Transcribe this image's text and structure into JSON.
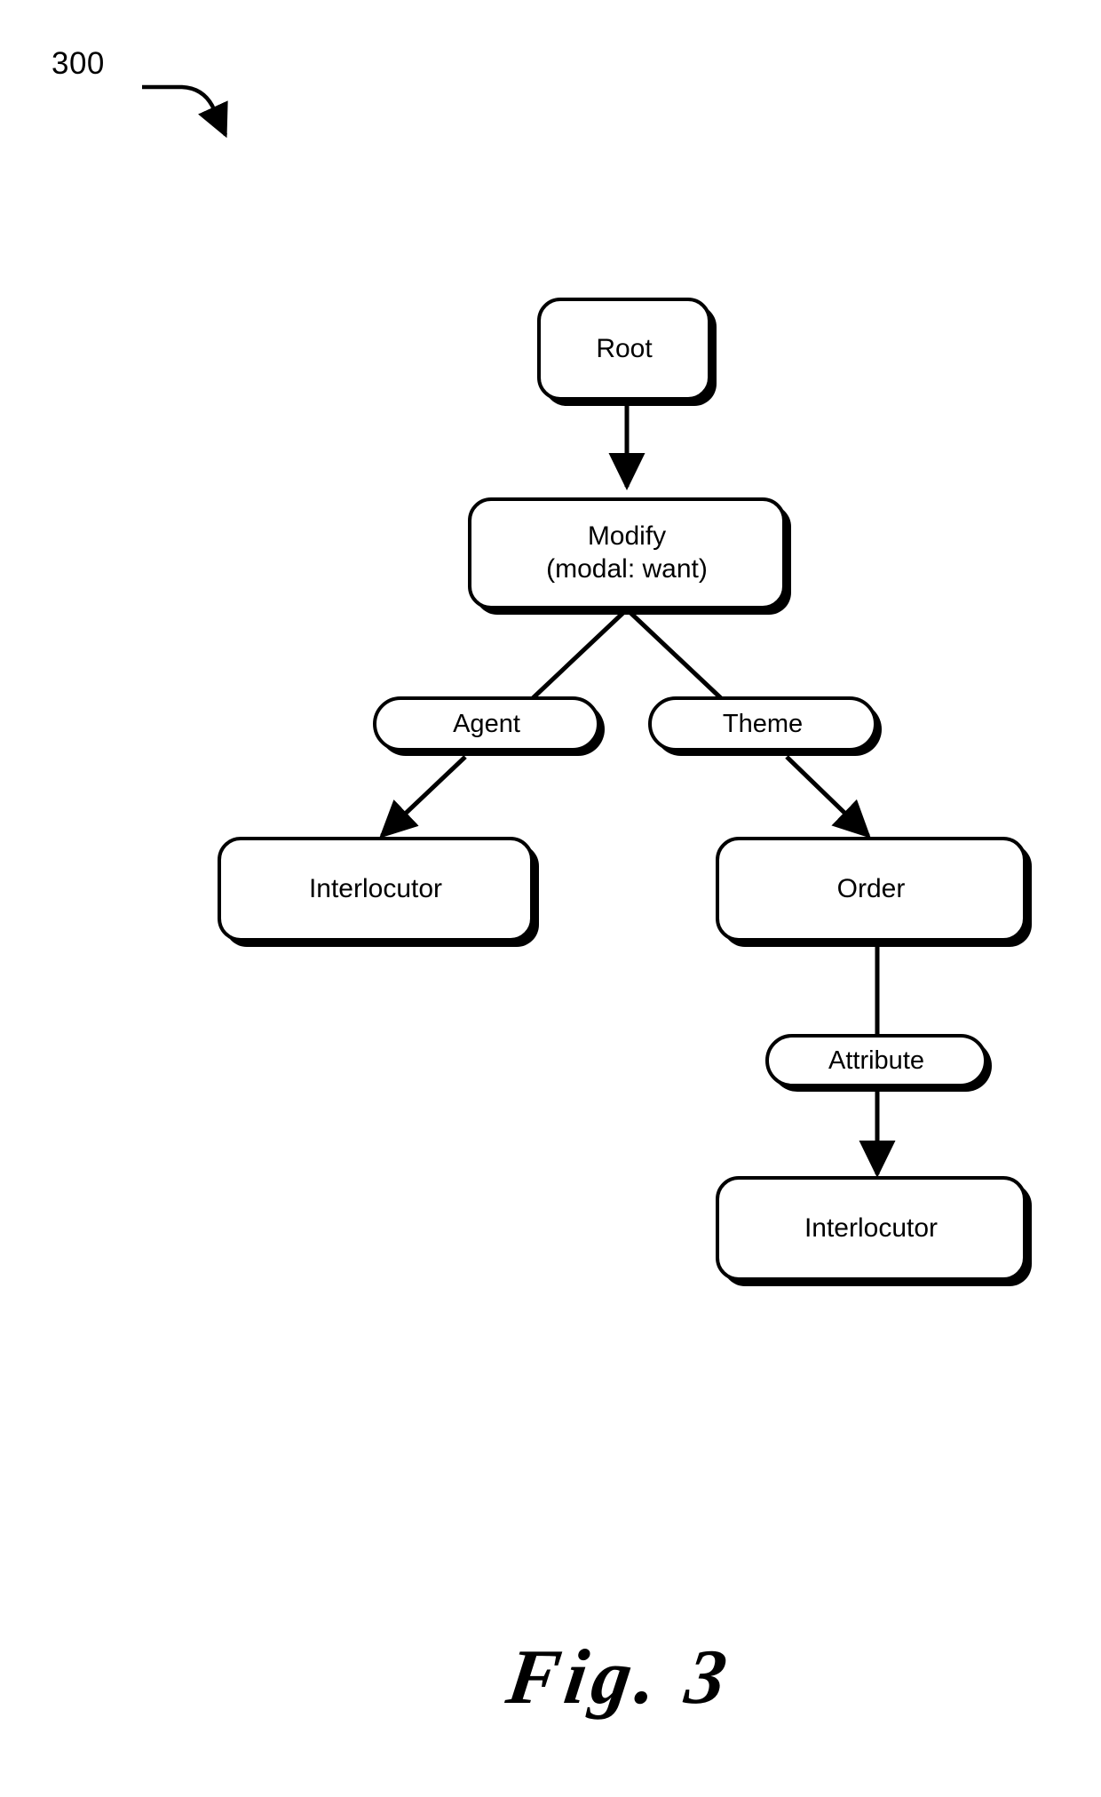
{
  "figure": {
    "reference_numeral": "300",
    "caption": "Fig. 3"
  },
  "diagram": {
    "type": "tree",
    "nodes": [
      {
        "id": "root",
        "label": "Root",
        "shape": "box",
        "level": 0
      },
      {
        "id": "modify",
        "label_line1": "Modify",
        "label_line2": "(modal: want)",
        "shape": "box",
        "level": 1
      },
      {
        "id": "agent",
        "label": "Agent",
        "shape": "pill",
        "level": 2
      },
      {
        "id": "theme",
        "label": "Theme",
        "shape": "pill",
        "level": 2
      },
      {
        "id": "interlocutor1",
        "label": "Interlocutor",
        "shape": "box",
        "level": 3
      },
      {
        "id": "order",
        "label": "Order",
        "shape": "box",
        "level": 3
      },
      {
        "id": "attribute",
        "label": "Attribute",
        "shape": "pill",
        "level": 4
      },
      {
        "id": "interlocutor2",
        "label": "Interlocutor",
        "shape": "box",
        "level": 5
      }
    ],
    "edges": [
      {
        "from": "root",
        "to": "modify",
        "arrow": true
      },
      {
        "from": "modify",
        "to": "agent",
        "arrow": false
      },
      {
        "from": "modify",
        "to": "theme",
        "arrow": false
      },
      {
        "from": "agent",
        "to": "interlocutor1",
        "arrow": true
      },
      {
        "from": "theme",
        "to": "order",
        "arrow": true
      },
      {
        "from": "order",
        "to": "attribute",
        "arrow": false
      },
      {
        "from": "attribute",
        "to": "interlocutor2",
        "arrow": true
      }
    ]
  },
  "colors": {
    "stroke": "#000000",
    "fill": "#ffffff",
    "background": "#ffffff"
  }
}
